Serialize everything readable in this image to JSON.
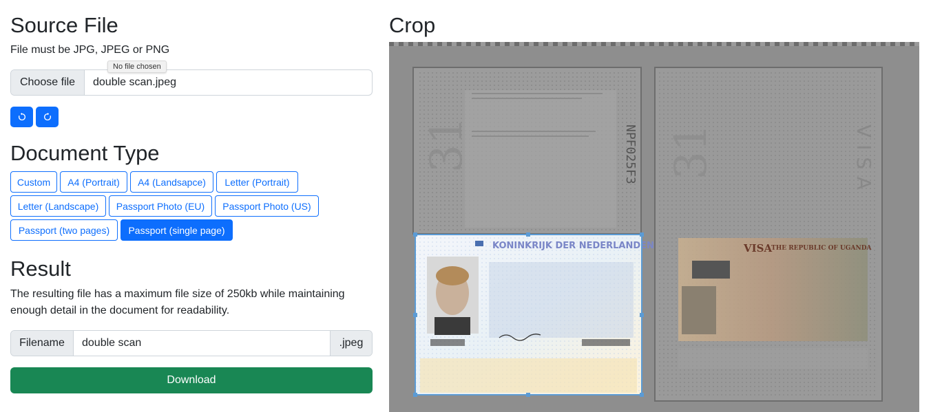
{
  "source": {
    "title": "Source File",
    "hint": "File must be JPG, JPEG or PNG",
    "choose_label": "Choose file",
    "file_name": "double scan.jpeg",
    "tooltip": "No file chosen",
    "rotate_icons": [
      "rotate-ccw-icon",
      "rotate-cw-icon"
    ]
  },
  "doctype": {
    "title": "Document Type",
    "options": [
      {
        "label": "Custom",
        "active": false
      },
      {
        "label": "A4 (Portrait)",
        "active": false
      },
      {
        "label": "A4 (Landsapce)",
        "active": false
      },
      {
        "label": "Letter (Portrait)",
        "active": false
      },
      {
        "label": "Letter (Landscape)",
        "active": false
      },
      {
        "label": "Passport Photo (EU)",
        "active": false
      },
      {
        "label": "Passport Photo (US)",
        "active": false
      },
      {
        "label": "Passport (two pages)",
        "active": false
      },
      {
        "label": "Passport (single page)",
        "active": true
      }
    ]
  },
  "result": {
    "title": "Result",
    "description": "The resulting file has a maximum file size of 250kb while maintaining enough detail in the document for readability.",
    "filename_label": "Filename",
    "filename_value": "double scan",
    "extension": ".jpeg",
    "download_label": "Download"
  },
  "crop": {
    "title": "Crop",
    "passport_header": "KONINKRIJK DER NEDERLANDEN",
    "visa_header": "VISA",
    "visa_country": "THE REPUBLIC OF UGANDA",
    "left_page_number": "31",
    "right_page_number": "31"
  },
  "colors": {
    "primary": "#0d6efd",
    "success": "#198754",
    "overlay": "#8e8e8e"
  }
}
